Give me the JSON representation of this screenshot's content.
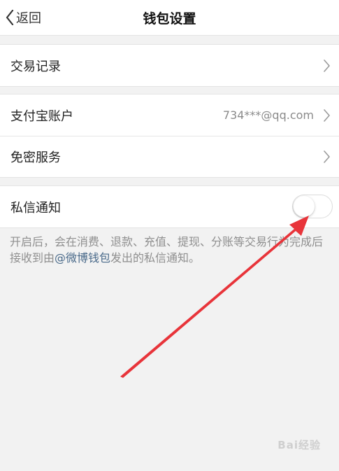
{
  "navbar": {
    "back_label": "返回",
    "title": "钱包设置"
  },
  "groups": {
    "records": {
      "label": "交易记录"
    },
    "account": {
      "alipay_label": "支付宝账户",
      "alipay_value": "734***@qq.com",
      "password_free_label": "免密服务"
    },
    "notify": {
      "label": "私信通知",
      "enabled": false
    }
  },
  "note": {
    "text_before": "开启后，会在消费、退款、充值、提现、分账等交易行为完成后接收到由",
    "link": "@微博钱包",
    "text_after": "发出的私信通知。"
  },
  "watermark": {
    "text": "Bai经验"
  },
  "colors": {
    "arrow": "#e8343a",
    "link": "#4a6a8a",
    "background": "#f2f2f2"
  }
}
